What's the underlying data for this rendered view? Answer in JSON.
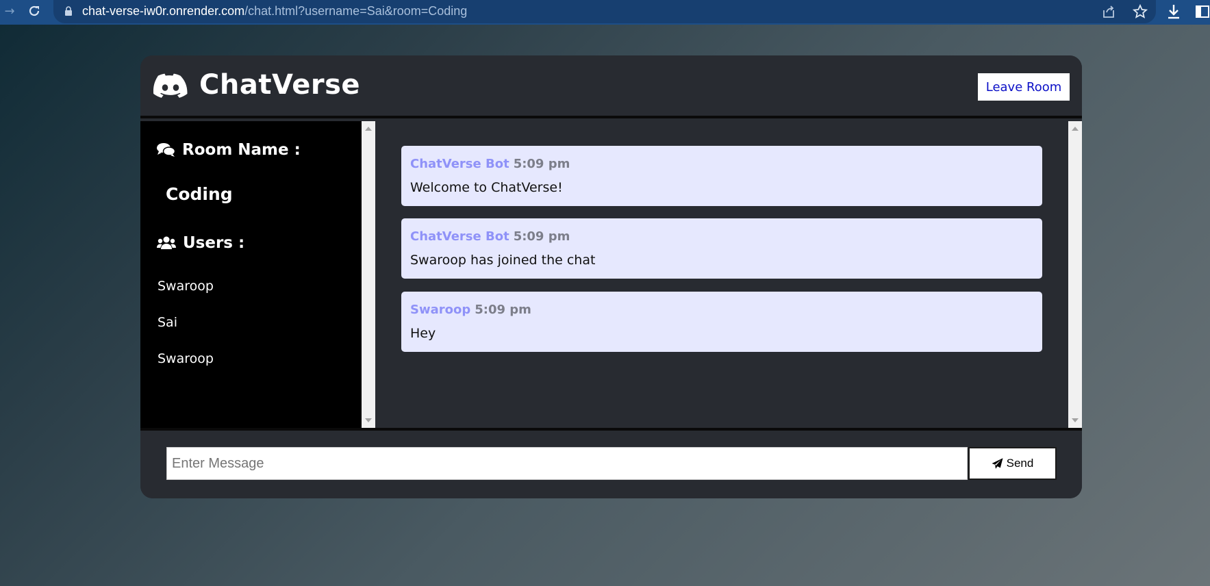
{
  "browser": {
    "url_host": "chat-verse-iw0r.onrender.com",
    "url_path": "/chat.html?username=Sai&room=Coding"
  },
  "header": {
    "brand": "ChatVerse",
    "leave_label": "Leave Room",
    "icon": "discord-icon"
  },
  "sidebar": {
    "room_heading": "Room Name :",
    "room_name": "Coding",
    "users_heading": "Users :",
    "users": [
      "Swaroop",
      "Sai",
      "Swaroop"
    ]
  },
  "messages": [
    {
      "user": "ChatVerse Bot",
      "time": "5:09 pm",
      "text": "Welcome to ChatVerse!"
    },
    {
      "user": "ChatVerse Bot",
      "time": "5:09 pm",
      "text": "Swaroop has joined the chat"
    },
    {
      "user": "Swaroop",
      "time": "5:09 pm",
      "text": "Hey"
    }
  ],
  "composer": {
    "placeholder": "Enter Message",
    "value": "",
    "send_label": "Send"
  },
  "colors": {
    "accent_user": "#8f92f8",
    "message_bg": "#e6e8fe",
    "leave_text": "#0c10c7"
  }
}
